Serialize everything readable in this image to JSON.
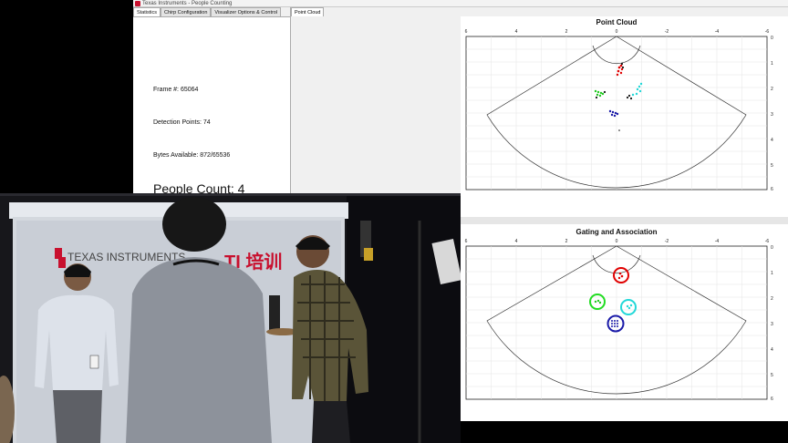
{
  "window": {
    "title": "Texas Instruments - People Counting"
  },
  "tabs": [
    {
      "label": "Statistics",
      "active": true
    },
    {
      "label": "Chirp Configuration",
      "active": false
    },
    {
      "label": "Visualizer Options & Control",
      "active": false
    }
  ],
  "stats": {
    "frame_label": "Frame #: 65064",
    "detection_label": "Detection Points: 74",
    "bytes_label": "Bytes Available: 872/65536",
    "people_label": "People Count: 4"
  },
  "right_tab": {
    "label": "Point Cloud"
  },
  "plots": [
    {
      "title": "Point Cloud",
      "x_ticks": [
        "6",
        "4",
        "2",
        "0",
        "-2",
        "-4",
        "-6"
      ],
      "y_ticks": [
        "0",
        "1",
        "2",
        "3",
        "4",
        "5",
        "6"
      ]
    },
    {
      "title": "Gating and Association",
      "x_ticks": [
        "6",
        "4",
        "2",
        "0",
        "-2",
        "-4",
        "-6"
      ],
      "y_ticks": [
        "0",
        "1",
        "2",
        "3",
        "4",
        "5",
        "6"
      ]
    }
  ],
  "video": {
    "banner_brand": "TEXAS INSTRUMENTS",
    "banner_ti": "TI 培训"
  },
  "colors": {
    "track_red": "#e00000",
    "track_green": "#22dd22",
    "track_cyan": "#22d8d8",
    "track_blue": "#1a1aa8",
    "ti_red": "#c8102e"
  }
}
